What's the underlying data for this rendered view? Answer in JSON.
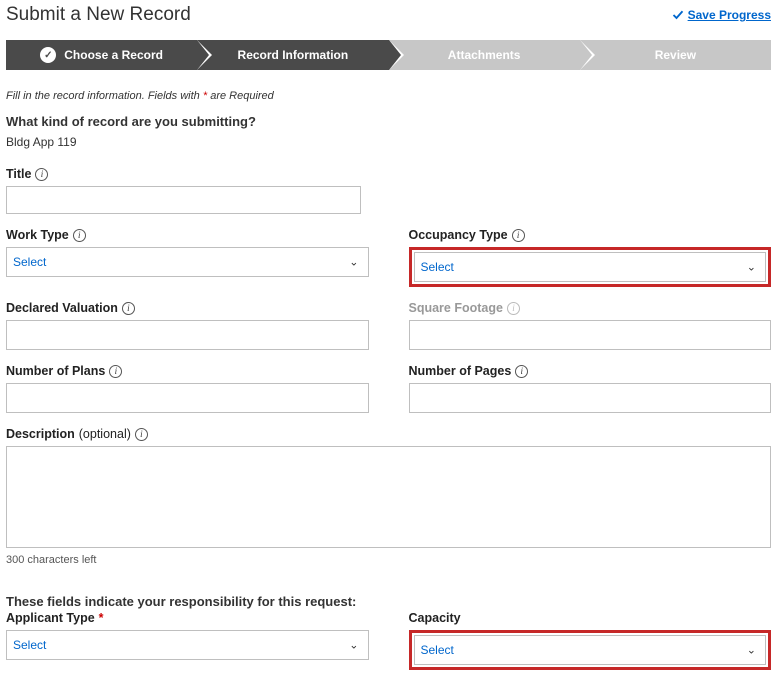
{
  "header": {
    "title": "Submit a New Record",
    "save_progress": "Save Progress"
  },
  "stepper": {
    "step1": "Choose a Record",
    "step2": "Record Information",
    "step3": "Attachments",
    "step4": "Review"
  },
  "hint": {
    "prefix": "Fill in the record information. Fields with ",
    "ast": "*",
    "suffix": " are Required"
  },
  "question": "What kind of record are you submitting?",
  "record_name": "Bldg App 119",
  "fields": {
    "title_label": "Title",
    "work_type_label": "Work Type",
    "work_type_value": "Select",
    "occupancy_type_label": "Occupancy Type",
    "occupancy_type_value": "Select",
    "declared_valuation_label": "Declared Valuation",
    "square_footage_label": "Square Footage",
    "number_plans_label": "Number of Plans",
    "number_pages_label": "Number of Pages",
    "description_label": "Description",
    "description_optional": "(optional)",
    "chars_left": "300 characters left",
    "section_header": "These fields indicate your responsibility for this request:",
    "applicant_type_label": "Applicant Type",
    "applicant_type_value": "Select",
    "capacity_label": "Capacity",
    "capacity_value": "Select"
  }
}
